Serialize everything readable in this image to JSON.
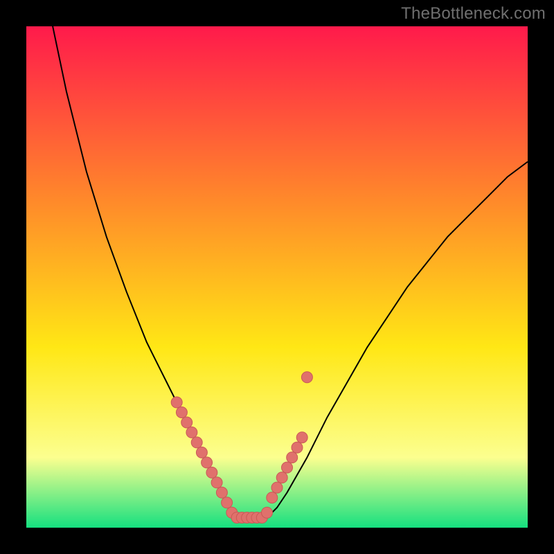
{
  "watermark": "TheBottleneck.com",
  "colors": {
    "background": "#000000",
    "grad_top": "#ff1a4b",
    "grad_mid1": "#ff8a2a",
    "grad_mid2": "#ffe715",
    "grad_mid3": "#fcff8f",
    "grad_bottom": "#15e07f",
    "curve": "#000000",
    "dot_fill": "#e0716c",
    "dot_stroke": "#c95a56"
  },
  "chart_data": {
    "type": "line",
    "title": "",
    "xlabel": "",
    "ylabel": "",
    "xlim": [
      0,
      100
    ],
    "ylim": [
      0,
      100
    ],
    "series": [
      {
        "name": "bottleneck-curve",
        "x": [
          0,
          4,
          8,
          12,
          16,
          20,
          24,
          26,
          28,
          30,
          32,
          34,
          36,
          37,
          38,
          39,
          40,
          41,
          42,
          43,
          44,
          46,
          48,
          50,
          52,
          56,
          60,
          64,
          68,
          72,
          76,
          80,
          84,
          88,
          92,
          96,
          100
        ],
        "y": [
          130,
          106,
          87,
          71,
          58,
          47,
          37,
          33,
          29,
          25,
          21,
          17,
          13,
          11,
          9,
          7,
          5,
          3,
          2,
          2,
          2,
          2,
          2,
          4,
          7,
          14,
          22,
          29,
          36,
          42,
          48,
          53,
          58,
          62,
          66,
          70,
          73
        ]
      }
    ],
    "dots": {
      "name": "highlight-dots",
      "x": [
        30,
        31,
        32,
        33,
        34,
        35,
        36,
        37,
        38,
        39,
        40,
        41,
        42,
        43,
        44,
        45,
        46,
        47,
        48,
        49,
        50,
        51,
        52,
        53,
        54,
        55,
        56
      ],
      "y": [
        25,
        23,
        21,
        19,
        17,
        15,
        13,
        11,
        9,
        7,
        5,
        3,
        2,
        2,
        2,
        2,
        2,
        2,
        3,
        6,
        8,
        10,
        12,
        14,
        16,
        18,
        30
      ]
    }
  }
}
